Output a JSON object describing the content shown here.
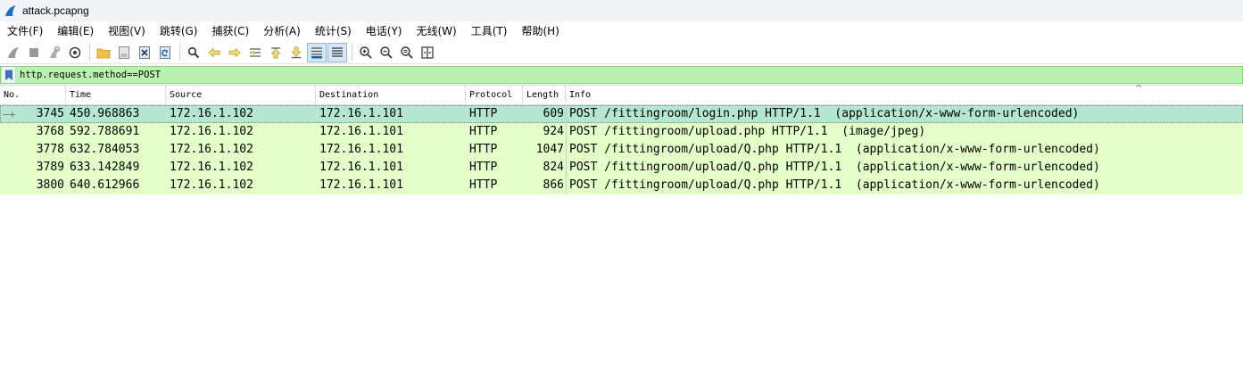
{
  "window": {
    "title": "attack.pcapng"
  },
  "menu": [
    "文件(F)",
    "编辑(E)",
    "视图(V)",
    "跳转(G)",
    "捕获(C)",
    "分析(A)",
    "统计(S)",
    "电话(Y)",
    "无线(W)",
    "工具(T)",
    "帮助(H)"
  ],
  "toolbar": {
    "buttons": [
      "shark-fin-start-icon",
      "stop-square-icon",
      "restart-fin-icon",
      "capture-options-gear-icon",
      "open-folder-icon",
      "save-file-icon",
      "close-file-icon",
      "reload-file-icon",
      "find-magnifier-icon",
      "go-back-arrow-icon",
      "go-forward-arrow-icon",
      "go-to-packet-icon",
      "go-first-packet-icon",
      "go-last-packet-icon",
      "auto-scroll-icon",
      "colorize-list-icon",
      "zoom-in-icon",
      "zoom-out-icon",
      "zoom-normal-icon",
      "resize-columns-icon"
    ]
  },
  "filter": {
    "value": "http.request.method==POST"
  },
  "columns": [
    "No.",
    "Time",
    "Source",
    "Destination",
    "Protocol",
    "Length",
    "Info"
  ],
  "packets": [
    {
      "no": "3745",
      "time": "450.968863",
      "source": "172.16.1.102",
      "destination": "172.16.1.101",
      "protocol": "HTTP",
      "length": "609",
      "info": "POST /fittingroom/login.php HTTP/1.1  (application/x-www-form-urlencoded)",
      "selected": true
    },
    {
      "no": "3768",
      "time": "592.788691",
      "source": "172.16.1.102",
      "destination": "172.16.1.101",
      "protocol": "HTTP",
      "length": "924",
      "info": "POST /fittingroom/upload.php HTTP/1.1  (image/jpeg)",
      "selected": false
    },
    {
      "no": "3778",
      "time": "632.784053",
      "source": "172.16.1.102",
      "destination": "172.16.1.101",
      "protocol": "HTTP",
      "length": "1047",
      "info": "POST /fittingroom/upload/Q.php HTTP/1.1  (application/x-www-form-urlencoded)",
      "selected": false
    },
    {
      "no": "3789",
      "time": "633.142849",
      "source": "172.16.1.102",
      "destination": "172.16.1.101",
      "protocol": "HTTP",
      "length": "824",
      "info": "POST /fittingroom/upload/Q.php HTTP/1.1  (application/x-www-form-urlencoded)",
      "selected": false
    },
    {
      "no": "3800",
      "time": "640.612966",
      "source": "172.16.1.102",
      "destination": "172.16.1.101",
      "protocol": "HTTP",
      "length": "866",
      "info": "POST /fittingroom/upload/Q.php HTTP/1.1  (application/x-www-form-urlencoded)",
      "selected": false
    }
  ],
  "colors": {
    "http_row": "#e4ffc7",
    "selected_row": "#b4e6d0",
    "filter_valid": "#b9f1b0"
  }
}
